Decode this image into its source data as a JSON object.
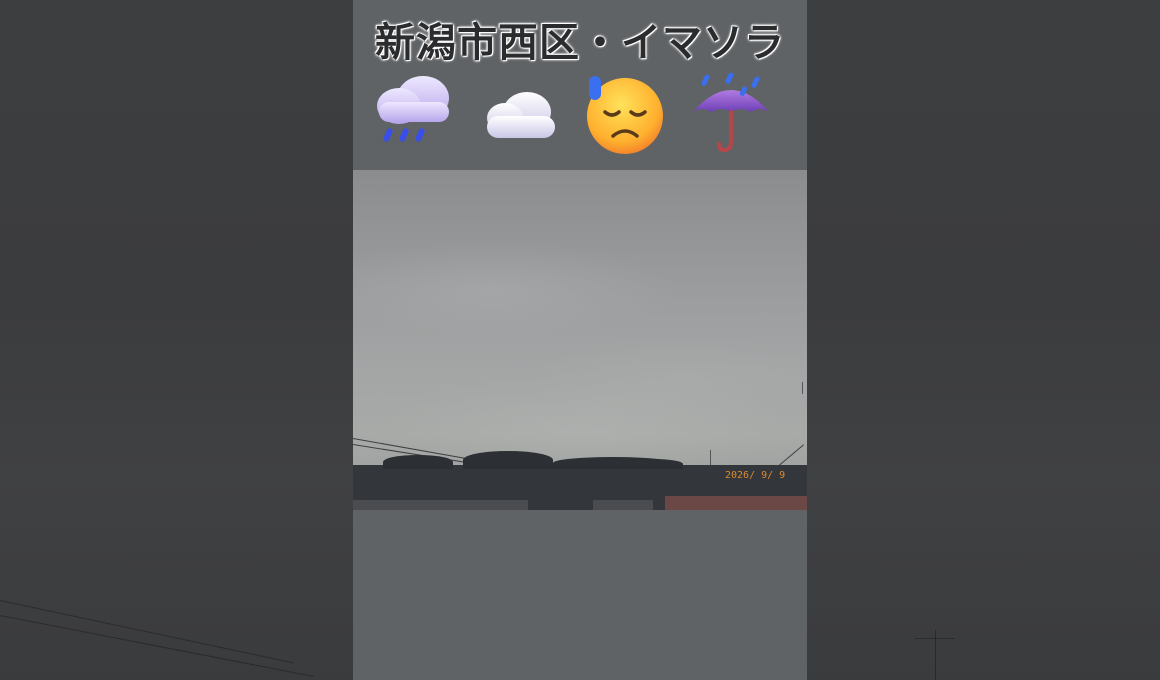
{
  "title": "新潟市西区・イマソラ",
  "weather_icons": [
    {
      "name": "cloud-with-rain-icon"
    },
    {
      "name": "cloud-icon"
    },
    {
      "name": "downcast-face-with-sweat-icon"
    },
    {
      "name": "umbrella-with-rain-drops-icon"
    }
  ],
  "photo": {
    "timestamp": "2026/ 9/ 9"
  },
  "colors": {
    "background": "#3a3b3d",
    "column": "#606366",
    "timestamp": "#e08a2e"
  }
}
